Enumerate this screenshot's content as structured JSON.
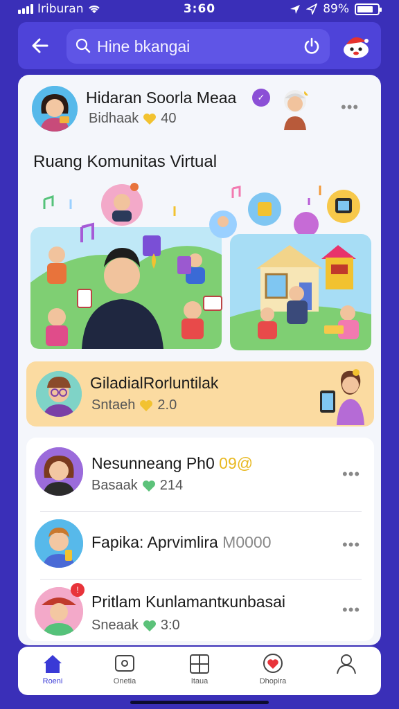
{
  "status_bar": {
    "carrier": "Iriburan",
    "time": "3:60",
    "battery": "89%"
  },
  "header": {
    "search_text": "Hine bkangai"
  },
  "post": {
    "author": "Hidaran Soorla Meaa",
    "meta_label": "Bidhaak",
    "meta_count": "40",
    "title": "Ruang Komunitas Virtual"
  },
  "highlight": {
    "name": "GiladialRorluntilak",
    "meta_label": "Sntaeh",
    "meta_count": "2.0"
  },
  "list": [
    {
      "name": "Nesunneang Ph0",
      "badge": "09@",
      "meta_label": "Basaak",
      "meta_count": "214"
    },
    {
      "name": "Fapika: Aprvimlira",
      "suffix": "M0000",
      "meta_label": "",
      "meta_count": ""
    },
    {
      "name": "Pritlam Kunlamantĸunbasai",
      "meta_label": "Sneaak",
      "meta_count": "3:0"
    }
  ],
  "nav": [
    {
      "label": "Roeni",
      "icon": "home-icon"
    },
    {
      "label": "Onetia",
      "icon": "message-icon"
    },
    {
      "label": "Itaua",
      "icon": "grid-icon"
    },
    {
      "label": "Dhopira",
      "icon": "heart-location-icon"
    },
    {
      "label": "",
      "icon": "profile-icon"
    }
  ],
  "colors": {
    "background": "#3a2fb8",
    "accent": "#4e43d9",
    "highlight": "#fbdba1",
    "heart_yellow": "#f2c230",
    "heart_green": "#5cc27a"
  }
}
